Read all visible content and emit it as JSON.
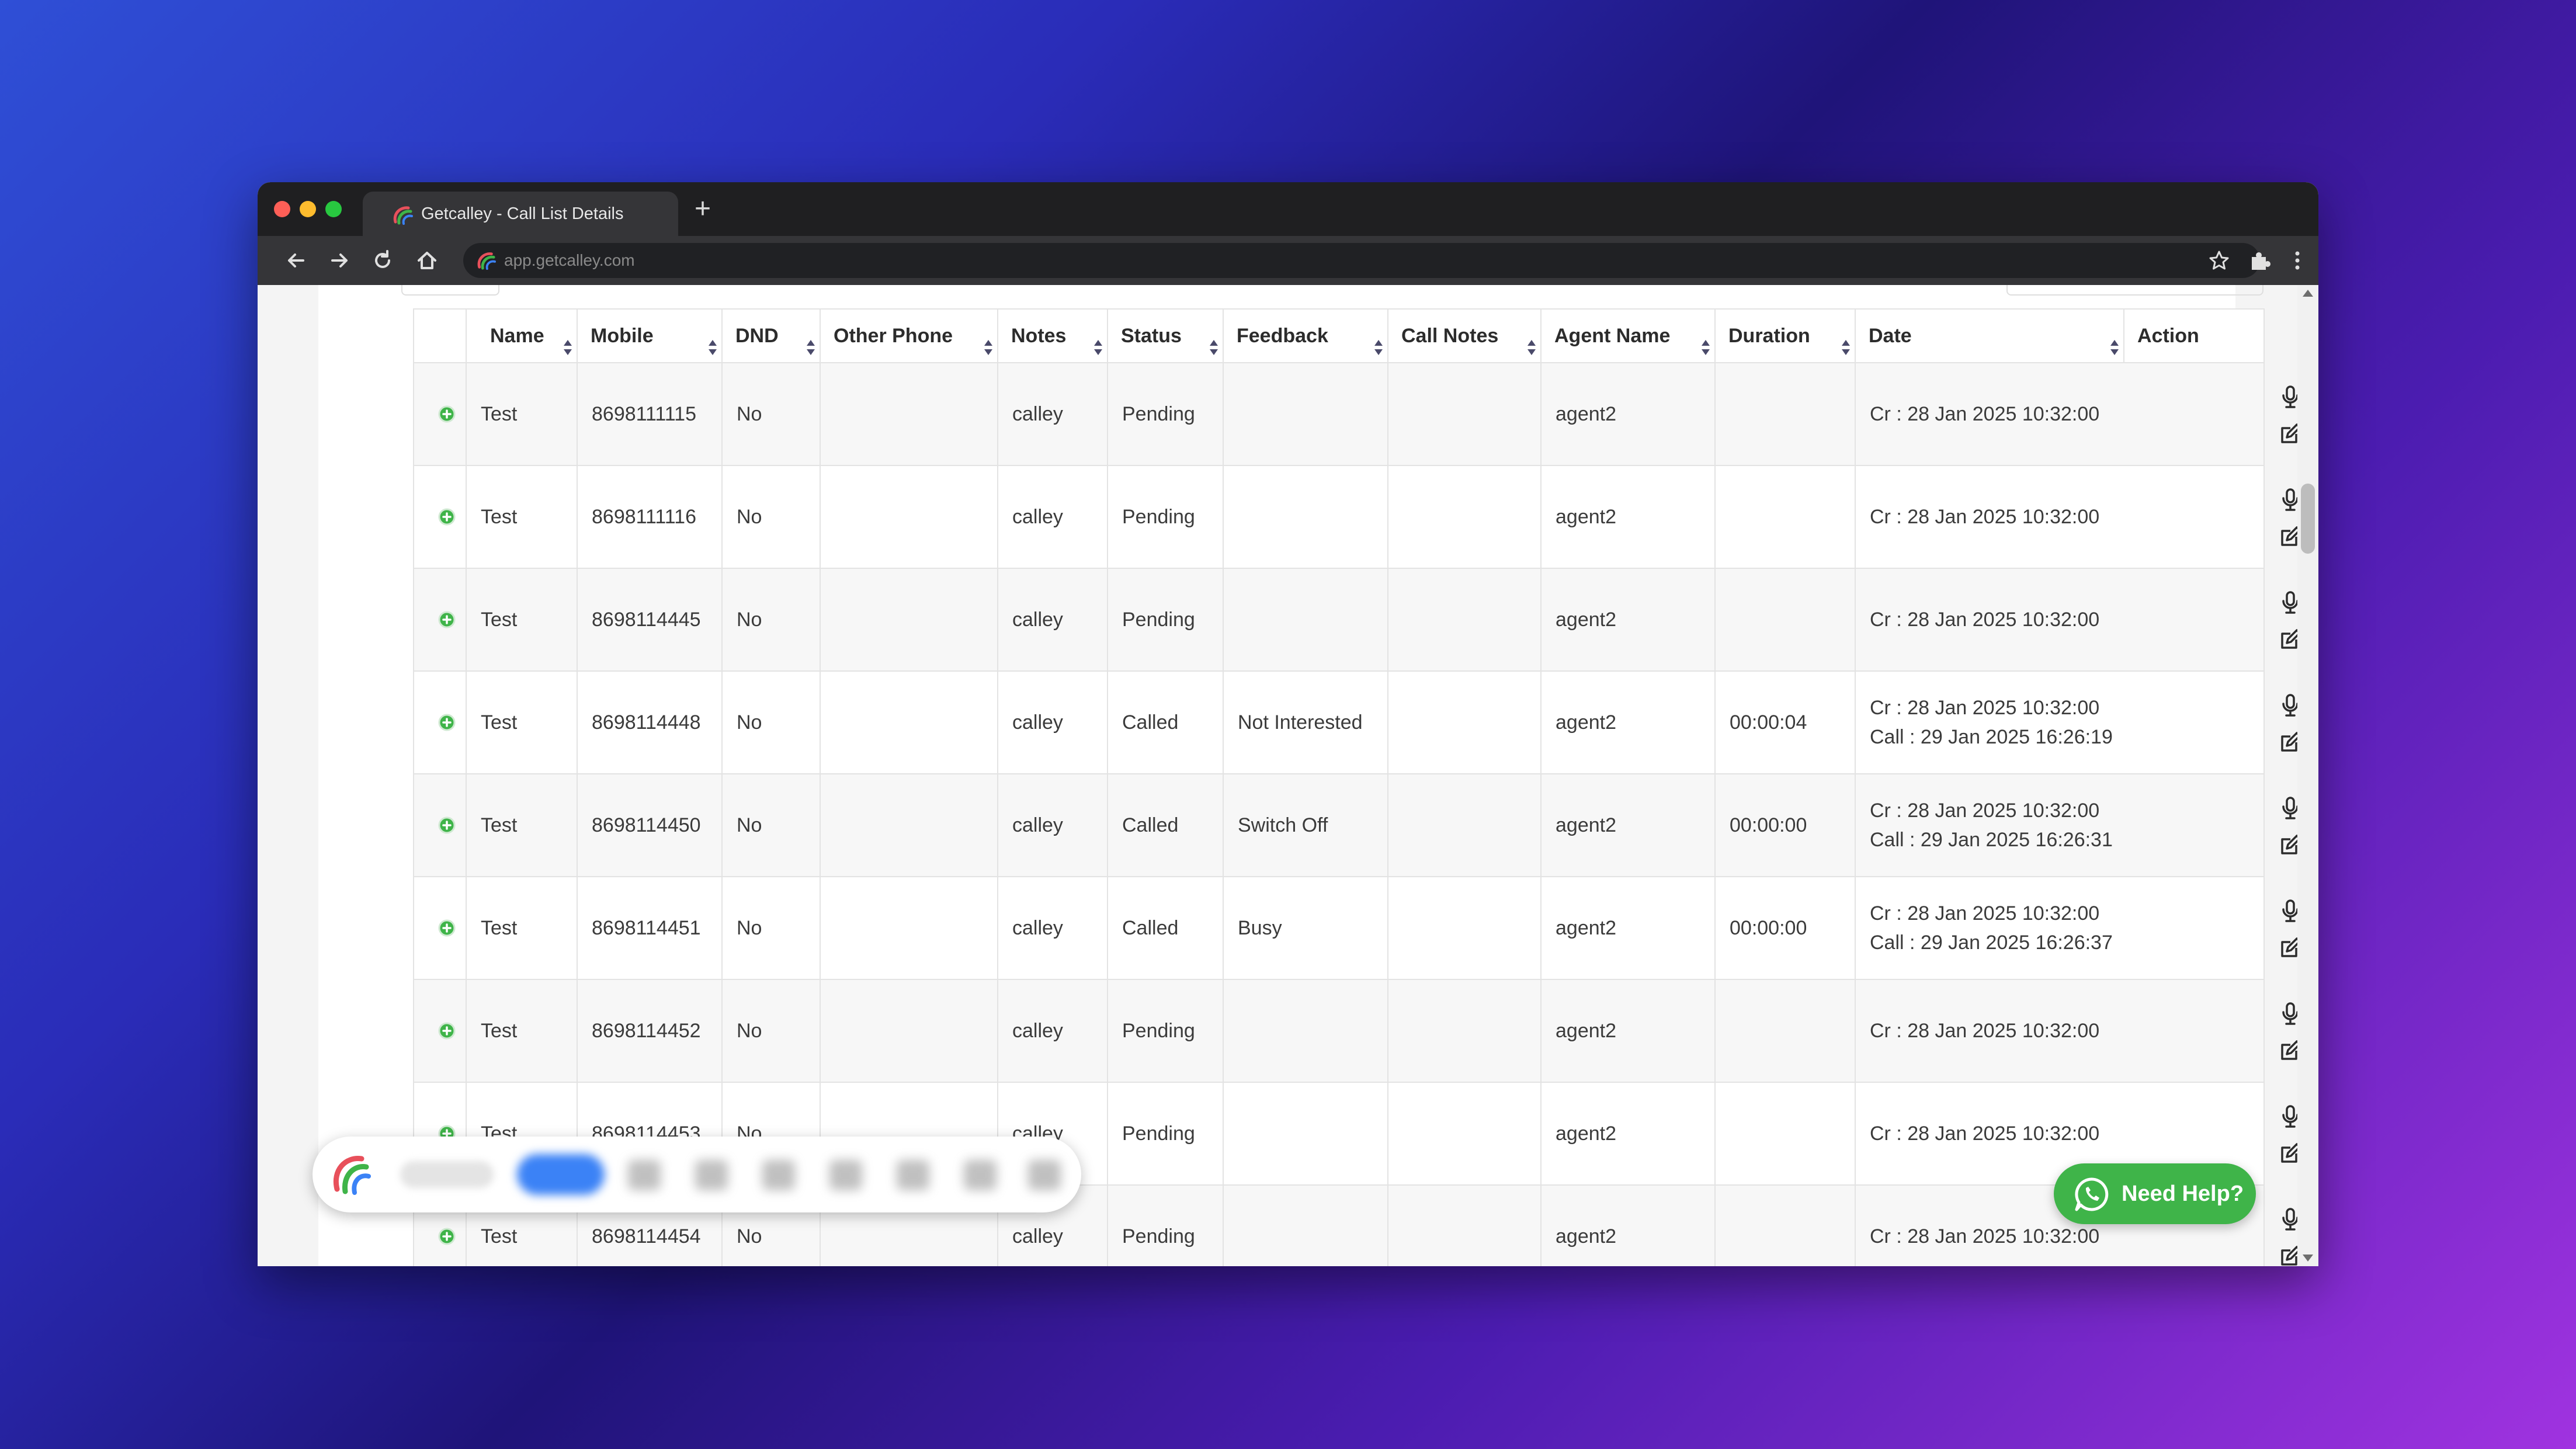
{
  "browser": {
    "tab_title": "Getcalley - Call List Details",
    "url": "app.getcalley.com",
    "new_tab": "+"
  },
  "table": {
    "columns": [
      "Name",
      "Mobile",
      "DND",
      "Other Phone",
      "Notes",
      "Status",
      "Feedback",
      "Call Notes",
      "Agent Name",
      "Duration",
      "Date",
      "Action"
    ],
    "rows": [
      {
        "name": "Test",
        "mobile": "8698111115",
        "dnd": "No",
        "other_phone": "",
        "notes": "calley",
        "status": "Pending",
        "feedback": "",
        "call_notes": "",
        "agent": "agent2",
        "duration": "",
        "date_cr": "Cr : 28 Jan 2025 10:32:00",
        "date_call": ""
      },
      {
        "name": "Test",
        "mobile": "8698111116",
        "dnd": "No",
        "other_phone": "",
        "notes": "calley",
        "status": "Pending",
        "feedback": "",
        "call_notes": "",
        "agent": "agent2",
        "duration": "",
        "date_cr": "Cr : 28 Jan 2025 10:32:00",
        "date_call": ""
      },
      {
        "name": "Test",
        "mobile": "8698114445",
        "dnd": "No",
        "other_phone": "",
        "notes": "calley",
        "status": "Pending",
        "feedback": "",
        "call_notes": "",
        "agent": "agent2",
        "duration": "",
        "date_cr": "Cr : 28 Jan 2025 10:32:00",
        "date_call": ""
      },
      {
        "name": "Test",
        "mobile": "8698114448",
        "dnd": "No",
        "other_phone": "",
        "notes": "calley",
        "status": "Called",
        "feedback": "Not Interested",
        "call_notes": "",
        "agent": "agent2",
        "duration": "00:00:04",
        "date_cr": "Cr : 28 Jan 2025 10:32:00",
        "date_call": "Call : 29 Jan 2025 16:26:19"
      },
      {
        "name": "Test",
        "mobile": "8698114450",
        "dnd": "No",
        "other_phone": "",
        "notes": "calley",
        "status": "Called",
        "feedback": "Switch Off",
        "call_notes": "",
        "agent": "agent2",
        "duration": "00:00:00",
        "date_cr": "Cr : 28 Jan 2025 10:32:00",
        "date_call": "Call : 29 Jan 2025 16:26:31"
      },
      {
        "name": "Test",
        "mobile": "8698114451",
        "dnd": "No",
        "other_phone": "",
        "notes": "calley",
        "status": "Called",
        "feedback": "Busy",
        "call_notes": "",
        "agent": "agent2",
        "duration": "00:00:00",
        "date_cr": "Cr : 28 Jan 2025 10:32:00",
        "date_call": "Call : 29 Jan 2025 16:26:37"
      },
      {
        "name": "Test",
        "mobile": "8698114452",
        "dnd": "No",
        "other_phone": "",
        "notes": "calley",
        "status": "Pending",
        "feedback": "",
        "call_notes": "",
        "agent": "agent2",
        "duration": "",
        "date_cr": "Cr : 28 Jan 2025 10:32:00",
        "date_call": ""
      },
      {
        "name": "Test",
        "mobile": "8698114453",
        "dnd": "No",
        "other_phone": "",
        "notes": "calley",
        "status": "Pending",
        "feedback": "",
        "call_notes": "",
        "agent": "agent2",
        "duration": "",
        "date_cr": "Cr : 28 Jan 2025 10:32:00",
        "date_call": ""
      },
      {
        "name": "Test",
        "mobile": "8698114454",
        "dnd": "No",
        "other_phone": "",
        "notes": "calley",
        "status": "Pending",
        "feedback": "",
        "call_notes": "",
        "agent": "agent2",
        "duration": "",
        "date_cr": "Cr : 28 Jan 2025 10:32:00",
        "date_call": ""
      }
    ]
  },
  "help": {
    "label": "Need Help?"
  },
  "icons": {
    "row_expand": "plus-circle-icon",
    "actions": [
      "microphone-icon",
      "clock-icon",
      "trash-icon",
      "edit-icon"
    ],
    "sort": "sort-icon",
    "help": "whatsapp-icon"
  },
  "colors": {
    "expand_green": "#3fb449",
    "help_green": "#3fb449",
    "tab_bar": "#1f1f21",
    "toolbar": "#353538"
  }
}
